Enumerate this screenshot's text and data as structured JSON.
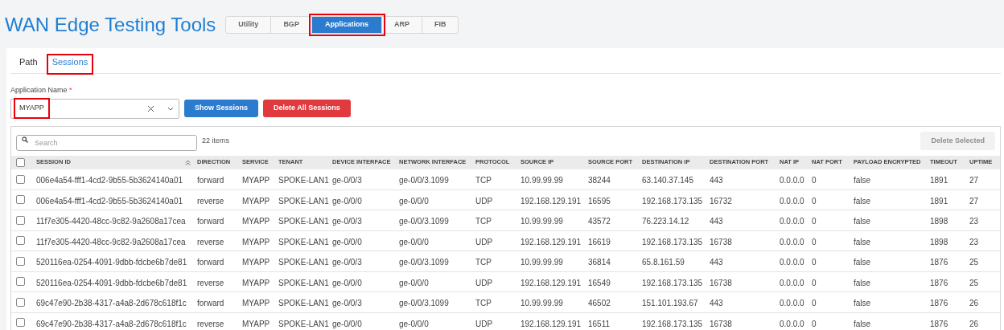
{
  "title": "WAN Edge Testing Tools",
  "tabs": [
    {
      "label": "Utility",
      "selected": false,
      "highlighted": false
    },
    {
      "label": "BGP",
      "selected": false,
      "highlighted": false
    },
    {
      "label": "Applications",
      "selected": true,
      "highlighted": true
    },
    {
      "label": "ARP",
      "selected": false,
      "highlighted": false
    },
    {
      "label": "FIB",
      "selected": false,
      "highlighted": false
    }
  ],
  "subtabs": [
    {
      "label": "Path",
      "selected": false,
      "highlighted": false
    },
    {
      "label": "Sessions",
      "selected": true,
      "highlighted": true
    }
  ],
  "app_field": {
    "label": "Application Name",
    "required_mark": "*",
    "value": "MYAPP",
    "highlighted": true
  },
  "buttons": [
    {
      "label": "Show Sessions",
      "kind": "primary"
    },
    {
      "label": "Delete All Sessions",
      "kind": "danger"
    }
  ],
  "search": {
    "placeholder": "Search"
  },
  "item_count": "22 items",
  "delete_selected": {
    "label": "Delete Selected",
    "disabled": true
  },
  "table": {
    "select_all_checked": false,
    "columns": [
      {
        "label": "SESSION ID",
        "sorted": true
      },
      {
        "label": "DIRECTION",
        "sorted": false
      },
      {
        "label": "SERVICE",
        "sorted": false
      },
      {
        "label": "TENANT",
        "sorted": false
      },
      {
        "label": "DEVICE INTERFACE",
        "sorted": false
      },
      {
        "label": "NETWORK INTERFACE",
        "sorted": false
      },
      {
        "label": "PROTOCOL",
        "sorted": false
      },
      {
        "label": "SOURCE IP",
        "sorted": false
      },
      {
        "label": "SOURCE PORT",
        "sorted": false
      },
      {
        "label": "DESTINATION IP",
        "sorted": false
      },
      {
        "label": "DESTINATION PORT",
        "sorted": false
      },
      {
        "label": "NAT IP",
        "sorted": false
      },
      {
        "label": "NAT PORT",
        "sorted": false
      },
      {
        "label": "PAYLOAD ENCRYPTED",
        "sorted": false
      },
      {
        "label": "TIMEOUT",
        "sorted": false
      },
      {
        "label": "UPTIME",
        "sorted": false
      }
    ],
    "rows": [
      {
        "checked": false,
        "cells": [
          "006e4a54-fff1-4cd2-9b55-5b3624140a01",
          "forward",
          "MYAPP",
          "SPOKE-LAN1",
          "ge-0/0/3",
          "ge-0/0/3.1099",
          "TCP",
          "10.99.99.99",
          "38244",
          "63.140.37.145",
          "443",
          "0.0.0.0",
          "0",
          "false",
          "1891",
          "27"
        ]
      },
      {
        "checked": false,
        "cells": [
          "006e4a54-fff1-4cd2-9b55-5b3624140a01",
          "reverse",
          "MYAPP",
          "SPOKE-LAN1",
          "ge-0/0/0",
          "ge-0/0/0",
          "UDP",
          "192.168.129.191",
          "16595",
          "192.168.173.135",
          "16732",
          "0.0.0.0",
          "0",
          "false",
          "1891",
          "27"
        ]
      },
      {
        "checked": false,
        "cells": [
          "11f7e305-4420-48cc-9c82-9a2608a17cea",
          "forward",
          "MYAPP",
          "SPOKE-LAN1",
          "ge-0/0/3",
          "ge-0/0/3.1099",
          "TCP",
          "10.99.99.99",
          "43572",
          "76.223.14.12",
          "443",
          "0.0.0.0",
          "0",
          "false",
          "1898",
          "23"
        ]
      },
      {
        "checked": false,
        "cells": [
          "11f7e305-4420-48cc-9c82-9a2608a17cea",
          "reverse",
          "MYAPP",
          "SPOKE-LAN1",
          "ge-0/0/0",
          "ge-0/0/0",
          "UDP",
          "192.168.129.191",
          "16619",
          "192.168.173.135",
          "16738",
          "0.0.0.0",
          "0",
          "false",
          "1898",
          "23"
        ]
      },
      {
        "checked": false,
        "cells": [
          "520116ea-0254-4091-9dbb-fdcbe6b7de81",
          "forward",
          "MYAPP",
          "SPOKE-LAN1",
          "ge-0/0/3",
          "ge-0/0/3.1099",
          "TCP",
          "10.99.99.99",
          "36814",
          "65.8.161.59",
          "443",
          "0.0.0.0",
          "0",
          "false",
          "1876",
          "25"
        ]
      },
      {
        "checked": false,
        "cells": [
          "520116ea-0254-4091-9dbb-fdcbe6b7de81",
          "reverse",
          "MYAPP",
          "SPOKE-LAN1",
          "ge-0/0/0",
          "ge-0/0/0",
          "UDP",
          "192.168.129.191",
          "16549",
          "192.168.173.135",
          "16738",
          "0.0.0.0",
          "0",
          "false",
          "1876",
          "25"
        ]
      },
      {
        "checked": false,
        "cells": [
          "69c47e90-2b38-4317-a4a8-2d678c618f1c",
          "forward",
          "MYAPP",
          "SPOKE-LAN1",
          "ge-0/0/3",
          "ge-0/0/3.1099",
          "TCP",
          "10.99.99.99",
          "46502",
          "151.101.193.67",
          "443",
          "0.0.0.0",
          "0",
          "false",
          "1876",
          "26"
        ]
      },
      {
        "checked": false,
        "cells": [
          "69c47e90-2b38-4317-a4a8-2d678c618f1c",
          "reverse",
          "MYAPP",
          "SPOKE-LAN1",
          "ge-0/0/0",
          "ge-0/0/0",
          "UDP",
          "192.168.129.191",
          "16511",
          "192.168.173.135",
          "16738",
          "0.0.0.0",
          "0",
          "false",
          "1876",
          "26"
        ]
      }
    ]
  }
}
